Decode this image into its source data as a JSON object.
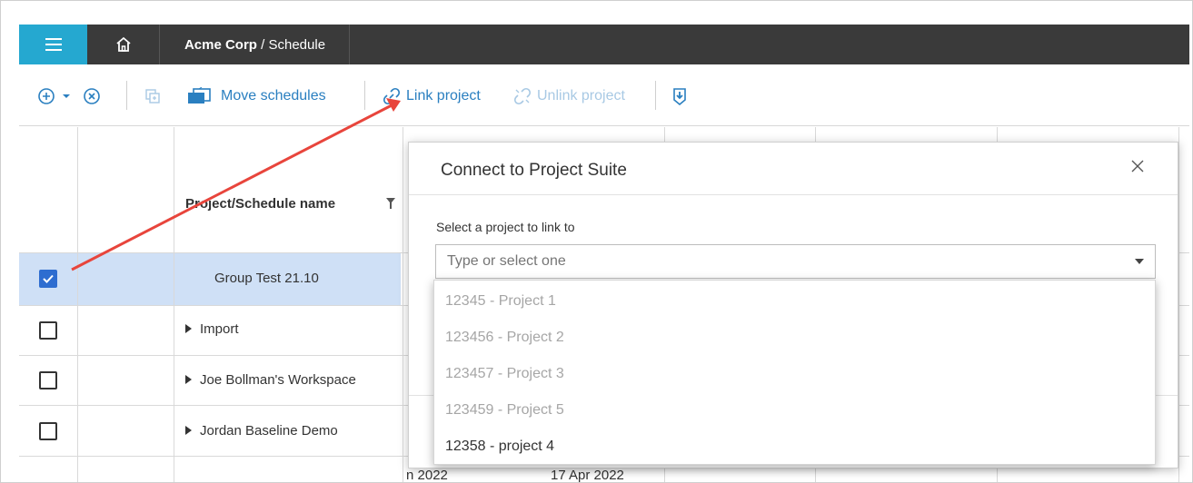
{
  "topbar": {
    "breadcrumb_org": "Acme Corp",
    "breadcrumb_sep": " / ",
    "breadcrumb_page": "Schedule",
    "accent_color": "#25a8d0",
    "bar_color": "#3a3a3a"
  },
  "toolbar": {
    "move_schedules": "Move schedules",
    "link_project": "Link project",
    "unlink_project": "Unlink project"
  },
  "grid": {
    "header_name": "Project/Schedule name",
    "rows": [
      {
        "name": "Group Test 21.10",
        "checked": true,
        "expandable": false
      },
      {
        "name": "Import",
        "checked": false,
        "expandable": true
      },
      {
        "name": "Joe Bollman's Workspace",
        "checked": false,
        "expandable": true
      },
      {
        "name": "Jordan Baseline Demo",
        "checked": false,
        "expandable": true
      }
    ],
    "peek_left": "n 2022",
    "peek_right": "17 Apr 2022"
  },
  "dialog": {
    "title": "Connect to Project Suite",
    "label": "Select a project to link to",
    "placeholder": "Type or select one",
    "options": [
      {
        "label": "12345 - Project 1",
        "enabled": false
      },
      {
        "label": "123456 - Project 2",
        "enabled": false
      },
      {
        "label": "123457 - Project 3",
        "enabled": false
      },
      {
        "label": "123459 - Project 5",
        "enabled": false
      },
      {
        "label": "12358 - project 4",
        "enabled": true
      }
    ]
  },
  "annotation": {
    "arrow_color": "#e8453c"
  }
}
